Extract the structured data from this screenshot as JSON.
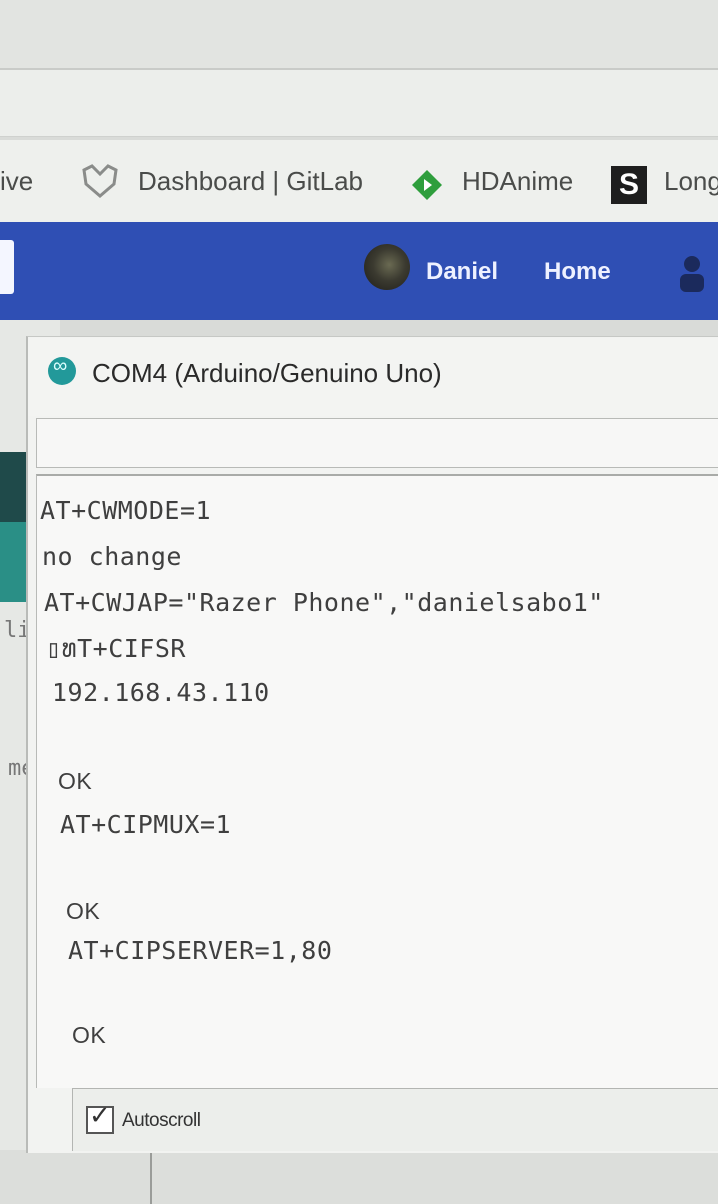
{
  "browser": {
    "bookmarks": [
      {
        "label": "ive",
        "icon": "folder-icon"
      },
      {
        "label": "Dashboard | GitLab",
        "icon": "gitlab-icon"
      },
      {
        "label": "HDAnime",
        "icon": "hdanime-icon"
      },
      {
        "label": "Long",
        "icon": "s-icon"
      }
    ]
  },
  "site_nav": {
    "user_name": "Daniel",
    "home_label": "Home",
    "people_icon": "people-icon"
  },
  "background_page": {
    "fragment_1": "li",
    "fragment_2": "me"
  },
  "serial_monitor": {
    "title": "COM4 (Arduino/Genuino Uno)",
    "send_input_value": "",
    "output_lines": [
      "AT+CWMODE=1",
      "no change",
      "AT+CWJAP=\"Razer Phone\",\"danielsabo1\"",
      "▯ທT+CIFSR",
      "192.168.43.110",
      "OK",
      "AT+CIPMUX=1",
      "OK",
      "AT+CIPSERVER=1,80",
      "OK"
    ],
    "autoscroll_label": "Autoscroll",
    "autoscroll_checked": true
  }
}
